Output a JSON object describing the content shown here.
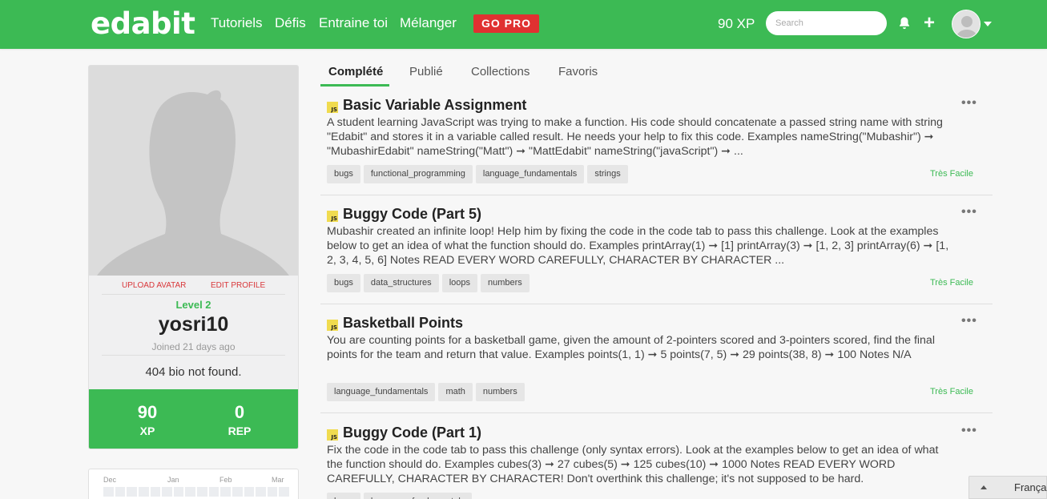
{
  "nav": {
    "logo": "edabit",
    "links": [
      "Tutoriels",
      "Défis",
      "Entraine toi",
      "Mélanger"
    ],
    "gopro": "GO PRO",
    "xp": "90 XP",
    "search_placeholder": "Search",
    "icons": [
      "bell-icon",
      "plus-icon",
      "avatar",
      "chevron-down-icon"
    ]
  },
  "profile": {
    "upload_avatar": "UPLOAD AVATAR",
    "edit_profile": "EDIT PROFILE",
    "level": "Level 2",
    "username": "yosri10",
    "joined": "Joined 21 days ago",
    "bio": "404 bio not found.",
    "xp_value": "90",
    "xp_label": "XP",
    "rep_value": "0",
    "rep_label": "REP"
  },
  "calendar": {
    "months": [
      "Dec",
      "Jan",
      "Feb",
      "Mar"
    ]
  },
  "tabs": [
    "Complété",
    "Publié",
    "Collections",
    "Favoris"
  ],
  "active_tab": "Complété",
  "challenges": [
    {
      "lang": "JS",
      "title": "Basic Variable Assignment",
      "description": "A student learning JavaScript was trying to make a function. His code should concatenate a passed string name with string \"Edabit\" and stores it in a variable called result. He needs your help to fix this code. Examples nameString(\"Mubashir\") ➞ \"MubashirEdabit\" nameString(\"Matt\") ➞ \"MattEdabit\" nameString(\"javaScript\") ➞ ...",
      "tags": [
        "bugs",
        "functional_programming",
        "language_fundamentals",
        "strings"
      ],
      "difficulty": "Très Facile"
    },
    {
      "lang": "JS",
      "title": "Buggy Code (Part 5)",
      "description": "Mubashir created an infinite loop! Help him by fixing the code in the code tab to pass this challenge. Look at the examples below to get an idea of what the function should do. Examples printArray(1) ➞ [1] printArray(3) ➞ [1, 2, 3] printArray(6) ➞ [1, 2, 3, 4, 5, 6] Notes READ EVERY WORD CAREFULLY, CHARACTER BY CHARACTER ...",
      "tags": [
        "bugs",
        "data_structures",
        "loops",
        "numbers"
      ],
      "difficulty": "Très Facile"
    },
    {
      "lang": "JS",
      "title": "Basketball Points",
      "description": "You are counting points for a basketball game, given the amount of 2-pointers scored and 3-pointers scored, find the final points for the team and return that value. Examples points(1, 1) ➞ 5 points(7, 5) ➞ 29 points(38, 8) ➞ 100 Notes N/A",
      "tags": [
        "language_fundamentals",
        "math",
        "numbers"
      ],
      "difficulty": "Très Facile"
    },
    {
      "lang": "JS",
      "title": "Buggy Code (Part 1)",
      "description": "Fix the code in the code tab to pass this challenge (only syntax errors). Look at the examples below to get an idea of what the function should do. Examples cubes(3) ➞ 27 cubes(5) ➞ 125 cubes(10) ➞ 1000 Notes READ EVERY WORD CAREFULLY, CHARACTER BY CHARACTER! Don't overthink this challenge; it's not supposed to be hard.",
      "tags": [
        "bugs",
        "language_fundamentals"
      ],
      "difficulty": "Très Facile"
    }
  ],
  "language_widget": {
    "label": "Français"
  },
  "colors": {
    "brand_green": "#3cba54",
    "gopro_red": "#e03131",
    "action_red": "#d9373a",
    "js_yellow": "#f0db4f"
  }
}
